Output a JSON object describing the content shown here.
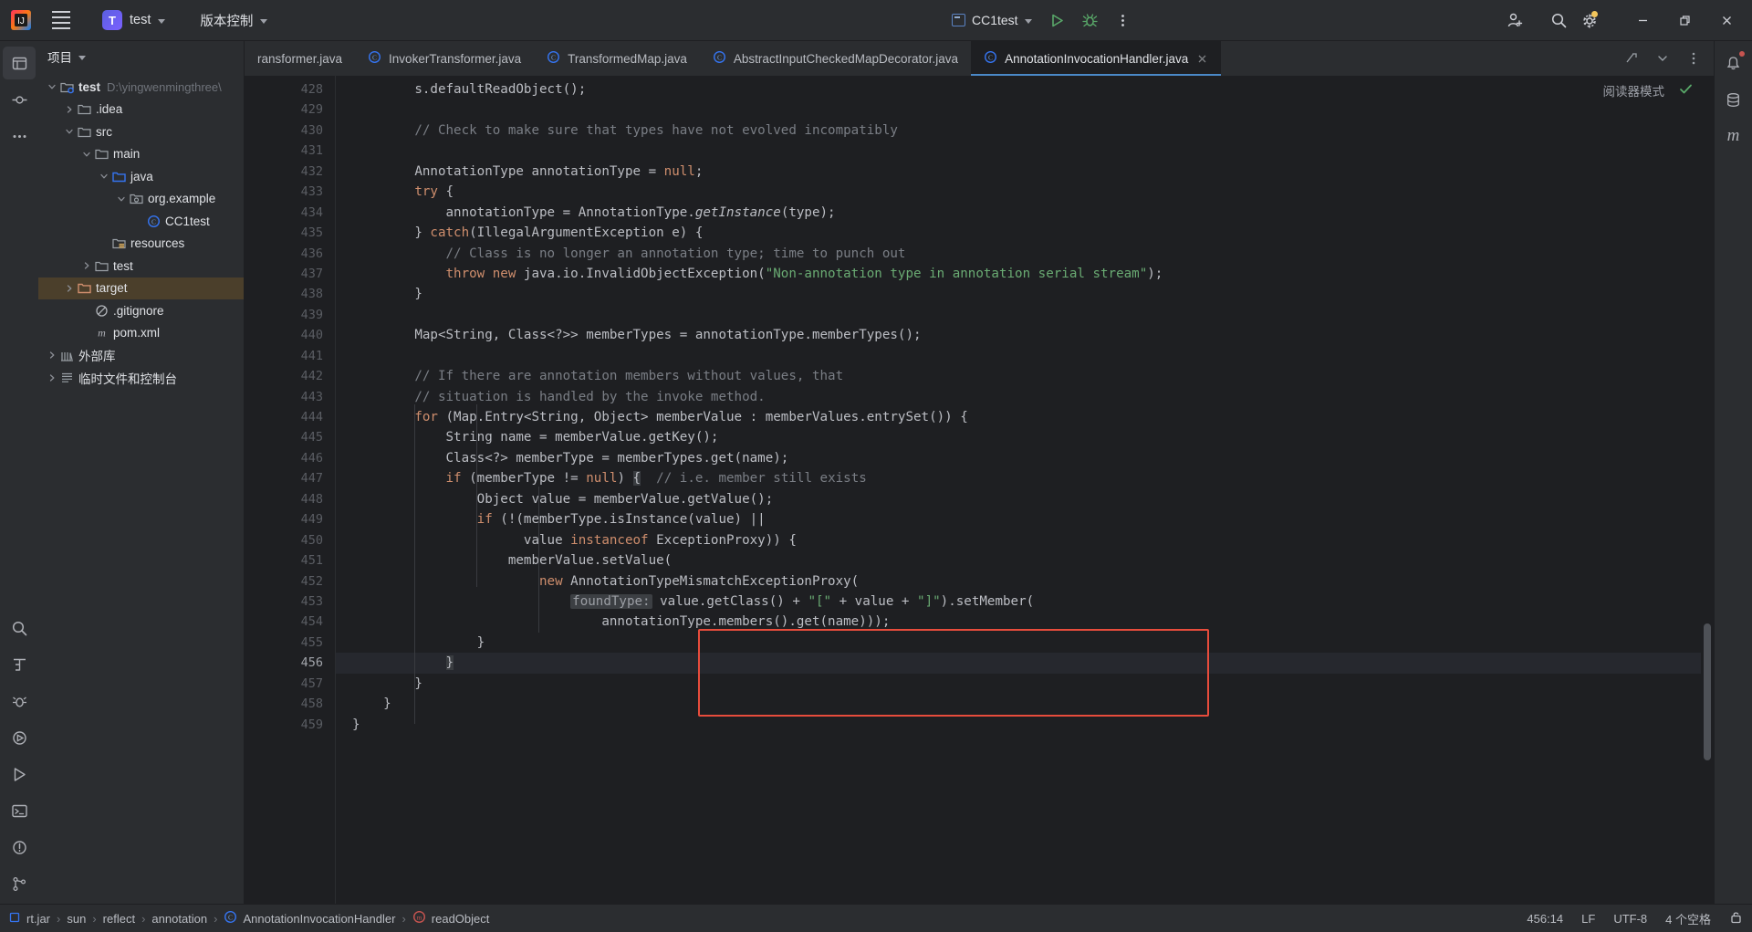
{
  "titlebar": {
    "menu_icon": "hamburger-menu-icon",
    "project_badge": "T",
    "project_name": "test",
    "vcs_label": "版本控制",
    "run_config": "CC1test",
    "run_icon": "run-play-icon",
    "debug_icon": "debug-bug-icon",
    "more_icon": "more-vertical-icon",
    "account_icon": "add-user-icon",
    "search_icon": "search-icon",
    "settings_icon": "gear-icon",
    "minimize_icon": "minimize-icon",
    "maximize_icon": "restore-icon",
    "close_icon": "close-icon"
  },
  "project_panel": {
    "title": "项目",
    "tree": [
      {
        "depth": 0,
        "arrow": "down",
        "icon": "module-folder-icon",
        "label": "test",
        "bold": true,
        "path": "D:\\yingwenmingthree\\",
        "selected": false
      },
      {
        "depth": 1,
        "arrow": "right",
        "icon": "folder-icon",
        "label": ".idea",
        "bold": false,
        "path": "",
        "selected": false
      },
      {
        "depth": 1,
        "arrow": "down",
        "icon": "folder-icon",
        "label": "src",
        "bold": false,
        "path": "",
        "selected": false
      },
      {
        "depth": 2,
        "arrow": "down",
        "icon": "folder-icon",
        "label": "main",
        "bold": false,
        "path": "",
        "selected": false
      },
      {
        "depth": 3,
        "arrow": "down",
        "icon": "source-folder-icon",
        "label": "java",
        "bold": false,
        "path": "",
        "selected": false
      },
      {
        "depth": 4,
        "arrow": "down",
        "icon": "package-icon",
        "label": "org.example",
        "bold": false,
        "path": "",
        "selected": false
      },
      {
        "depth": 5,
        "arrow": "none",
        "icon": "java-class-icon",
        "label": "CC1test",
        "bold": false,
        "path": "",
        "selected": false
      },
      {
        "depth": 3,
        "arrow": "none",
        "icon": "resources-folder-icon",
        "label": "resources",
        "bold": false,
        "path": "",
        "selected": false
      },
      {
        "depth": 2,
        "arrow": "right",
        "icon": "folder-icon",
        "label": "test",
        "bold": false,
        "path": "",
        "selected": false
      },
      {
        "depth": 1,
        "arrow": "right",
        "icon": "target-folder-icon",
        "label": "target",
        "bold": false,
        "path": "",
        "selected": true
      },
      {
        "depth": 2,
        "arrow": "none",
        "icon": "gitignore-icon",
        "label": ".gitignore",
        "bold": false,
        "path": "",
        "selected": false
      },
      {
        "depth": 2,
        "arrow": "none",
        "icon": "maven-icon",
        "label": "pom.xml",
        "bold": false,
        "path": "",
        "selected": false
      },
      {
        "depth": 0,
        "arrow": "right",
        "icon": "library-icon",
        "label": "外部库",
        "bold": false,
        "path": "",
        "selected": false
      },
      {
        "depth": 0,
        "arrow": "right",
        "icon": "scratches-icon",
        "label": "临时文件和控制台",
        "bold": false,
        "path": "",
        "selected": false
      }
    ]
  },
  "activity_bar_left": [
    "project-window-icon",
    "commit-icon",
    "more-tool-windows-icon",
    "search-everywhere-icon",
    "structure-icon",
    "debugger-icon",
    "services-icon",
    "run-icon",
    "terminal-icon",
    "problems-icon",
    "git-icon"
  ],
  "activity_bar_right": [
    "notifications-icon",
    "database-icon",
    "maven-icon"
  ],
  "tabs": [
    {
      "label": "ransformer.java",
      "icon": "java-class-icon",
      "active": false,
      "clipped": true
    },
    {
      "label": "InvokerTransformer.java",
      "icon": "java-class-icon",
      "active": false,
      "clipped": false
    },
    {
      "label": "TransformedMap.java",
      "icon": "java-class-icon",
      "active": false,
      "clipped": false
    },
    {
      "label": "AbstractInputCheckedMapDecorator.java",
      "icon": "java-class-icon",
      "active": false,
      "clipped": false
    },
    {
      "label": "AnnotationInvocationHandler.java",
      "icon": "java-class-icon",
      "active": true,
      "clipped": false
    }
  ],
  "editor": {
    "reader_mode_label": "阅读器模式",
    "inspection_ok_icon": "checkmark-icon",
    "first_line_number": 428,
    "current_line": 456,
    "lines": [
      {
        "n": 428,
        "html": "        s.defaultReadObject();"
      },
      {
        "n": 429,
        "html": ""
      },
      {
        "n": 430,
        "html": "        <span class=\"cmt\">// Check to make sure that types have not evolved incompatibly</span>"
      },
      {
        "n": 431,
        "html": ""
      },
      {
        "n": 432,
        "html": "        AnnotationType annotationType = <span class=\"kw\">null</span>;"
      },
      {
        "n": 433,
        "html": "        <span class=\"kw\">try</span> {"
      },
      {
        "n": 434,
        "html": "            annotationType = AnnotationType.<span class=\"ital\" style=\"font-style:italic\">getInstance</span>(type);"
      },
      {
        "n": 435,
        "html": "        } <span class=\"kw\">catch</span>(IllegalArgumentException e) {"
      },
      {
        "n": 436,
        "html": "            <span class=\"cmt\">// Class is no longer an annotation type; time to punch out</span>"
      },
      {
        "n": 437,
        "html": "            <span class=\"kw\">throw new</span> java.io.InvalidObjectException(<span class=\"str\">\"Non-annotation type in annotation serial stream\"</span>);"
      },
      {
        "n": 438,
        "html": "        }"
      },
      {
        "n": 439,
        "html": ""
      },
      {
        "n": 440,
        "html": "        Map&lt;String, Class&lt;?&gt;&gt; memberTypes = annotationType.memberTypes();"
      },
      {
        "n": 441,
        "html": ""
      },
      {
        "n": 442,
        "html": "        <span class=\"cmt\">// If there are annotation members without values, that</span>"
      },
      {
        "n": 443,
        "html": "        <span class=\"cmt\">// situation is handled by the invoke method.</span>"
      },
      {
        "n": 444,
        "html": "        <span class=\"kw\">for</span> (Map.Entry&lt;String, Object&gt; memberValue : memberValues.entrySet()) {"
      },
      {
        "n": 445,
        "html": "            String name = memberValue.getKey();"
      },
      {
        "n": 446,
        "html": "            Class&lt;?&gt; memberType = memberTypes.get(name);"
      },
      {
        "n": 447,
        "html": "            <span class=\"kw\">if</span> (memberType != <span class=\"kw\">null</span>) <span class=\"brmatch\">{</span>  <span class=\"cmt\">// i.e. member still exists</span>"
      },
      {
        "n": 448,
        "html": "                Object value = memberValue.getValue();"
      },
      {
        "n": 449,
        "html": "                <span class=\"kw\">if</span> (!(memberType.isInstance(value) ||"
      },
      {
        "n": 450,
        "html": "                      value <span class=\"kw\">instanceof</span> ExceptionProxy)) {"
      },
      {
        "n": 451,
        "html": "                    memberValue.setValue("
      },
      {
        "n": 452,
        "html": "                        <span class=\"kw\">new</span> AnnotationTypeMismatchExceptionProxy("
      },
      {
        "n": 453,
        "html": "                            <span class=\"param\">foundType:</span> value.getClass() + <span class=\"str\">\"[\"</span> + value + <span class=\"str\">\"]\"</span>).setMember("
      },
      {
        "n": 454,
        "html": "                                annotationType.members().get(name)));"
      },
      {
        "n": 455,
        "html": "                }"
      },
      {
        "n": 456,
        "html": "            <span class=\"brmatch\">}</span>"
      },
      {
        "n": 457,
        "html": "        }"
      },
      {
        "n": 458,
        "html": "    }"
      },
      {
        "n": 459,
        "html": "}"
      }
    ]
  },
  "breadcrumbs": [
    {
      "label": "rt.jar",
      "icon": "jar-icon"
    },
    {
      "label": "sun",
      "icon": ""
    },
    {
      "label": "reflect",
      "icon": ""
    },
    {
      "label": "annotation",
      "icon": ""
    },
    {
      "label": "AnnotationInvocationHandler",
      "icon": "java-class-icon"
    },
    {
      "label": "readObject",
      "icon": "java-method-icon"
    }
  ],
  "status_right": {
    "caret": "456:14",
    "line_separator": "LF",
    "encoding": "UTF-8",
    "indent": "4 个空格",
    "lock_icon": "unlocked-icon"
  },
  "colors": {
    "accent": "#4a88c7",
    "red_highlight": "#e74c3c",
    "selection": "#4b3f2b",
    "editor_bg": "#1e1f22",
    "panel_bg": "#2b2d30"
  }
}
